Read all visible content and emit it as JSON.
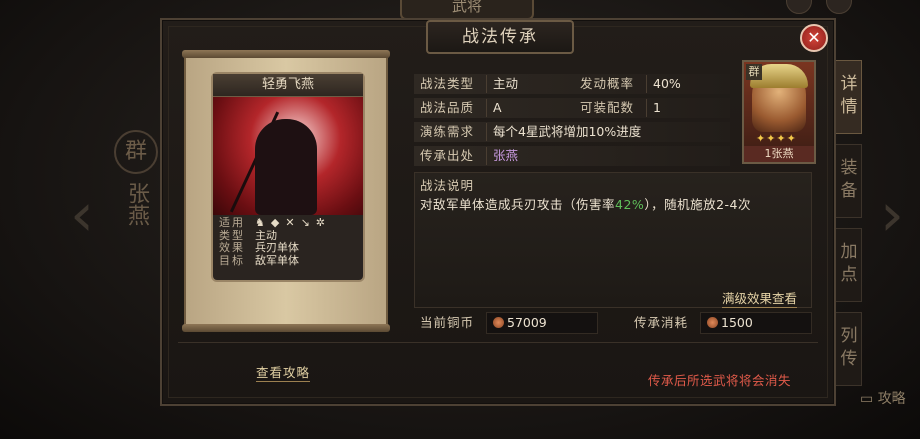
{
  "background": {
    "top_tab": "武将",
    "left_portrait_faction": "群",
    "left_portrait_name": "张燕",
    "right_tabs": [
      "详情",
      "装备",
      "加点",
      "列传"
    ],
    "guide_label": "攻略"
  },
  "dialog": {
    "title": "战法传承",
    "close_glyph": "✕"
  },
  "card": {
    "name": "轻勇飞燕",
    "rows": [
      {
        "key": "适用",
        "value": ""
      },
      {
        "key": "类型",
        "value": "主动"
      },
      {
        "key": "效果",
        "value": "兵刃单体"
      },
      {
        "key": "目标",
        "value": "敌军单体"
      }
    ],
    "troop_icons": [
      "cavalry-icon",
      "shield-icon",
      "bow-icon",
      "spear-icon",
      "chariot-icon"
    ]
  },
  "info": {
    "type_label": "战法类型",
    "type_value": "主动",
    "rate_label": "发动概率",
    "rate_value": "40%",
    "quality_label": "战法品质",
    "quality_value": "A",
    "slots_label": "可装配数",
    "slots_value": "1",
    "drill_label": "演练需求",
    "drill_value": "每个4星武将增加10%进度",
    "source_label": "传承出处",
    "source_value": "张燕"
  },
  "hero": {
    "faction": "群",
    "stars": "✦✦✦✦",
    "name": "1张燕"
  },
  "description": {
    "title": "战法说明",
    "text_before": "对敌军单体造成兵刃攻击（伤害率",
    "highlight": "42%",
    "text_after": "），随机施放2-4次"
  },
  "max_level_link": "满级效果查看",
  "cost": {
    "coins_label": "当前铜币",
    "coins_value": "57009",
    "consume_label": "传承消耗",
    "consume_value": "1500"
  },
  "guide_link": "查看攻略",
  "warning": "传承后所选武将将会消失",
  "colors": {
    "highlight": "#5fbf5a",
    "warning": "#e05a4a",
    "source": "#c89ae0"
  }
}
